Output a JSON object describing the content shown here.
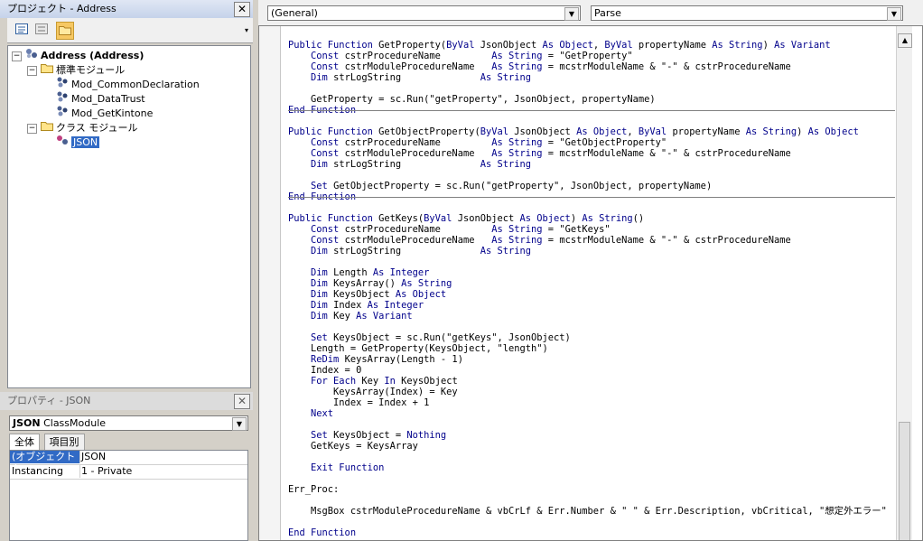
{
  "project": {
    "title": "プロジェクト - Address",
    "close": "✕",
    "tree": [
      {
        "label": "Address (Address)",
        "level": 0,
        "expander": "−",
        "icon": "vba-project-icon",
        "bold": true,
        "selected": false
      },
      {
        "label": "標準モジュール",
        "level": 1,
        "expander": "−",
        "icon": "folder-icon",
        "bold": false,
        "selected": false
      },
      {
        "label": "Mod_CommonDeclaration",
        "level": 2,
        "expander": "",
        "icon": "module-icon",
        "bold": false,
        "selected": false
      },
      {
        "label": "Mod_DataTrust",
        "level": 2,
        "expander": "",
        "icon": "module-icon",
        "bold": false,
        "selected": false
      },
      {
        "label": "Mod_GetKintone",
        "level": 2,
        "expander": "",
        "icon": "module-icon",
        "bold": false,
        "selected": false
      },
      {
        "label": "クラス モジュール",
        "level": 1,
        "expander": "−",
        "icon": "folder-icon",
        "bold": false,
        "selected": false
      },
      {
        "label": "JSON",
        "level": 2,
        "expander": "",
        "icon": "class-module-icon",
        "bold": false,
        "selected": true
      }
    ]
  },
  "properties": {
    "title": "プロパティ - JSON",
    "close": "✕",
    "object_name": "JSON",
    "object_type": "ClassModule",
    "tabs": [
      "全体",
      "項目別"
    ],
    "rows": [
      {
        "name": "(オブジェクト名)",
        "value": "JSON",
        "selected": true
      },
      {
        "name": "Instancing",
        "value": "1 - Private",
        "selected": false
      }
    ]
  },
  "code": {
    "object_combo": "(General)",
    "procedure_combo": "Parse",
    "lines": [
      [
        [
          "kw",
          "Public Function "
        ],
        [
          "",
          "GetProperty("
        ],
        [
          "kw",
          "ByVal "
        ],
        [
          "",
          "JsonObject "
        ],
        [
          "kw",
          "As Object"
        ],
        [
          "",
          ", "
        ],
        [
          "kw",
          "ByVal "
        ],
        [
          "",
          "propertyName "
        ],
        [
          "kw",
          "As String"
        ],
        [
          "",
          ") "
        ],
        [
          "kw",
          "As Variant"
        ]
      ],
      [
        [
          "",
          "    "
        ],
        [
          "kw",
          "Const "
        ],
        [
          "",
          "cstrProcedureName         "
        ],
        [
          "kw",
          "As String"
        ],
        [
          "",
          " = \"GetProperty\""
        ]
      ],
      [
        [
          "",
          "    "
        ],
        [
          "kw",
          "Const "
        ],
        [
          "",
          "cstrModuleProcedureName   "
        ],
        [
          "kw",
          "As String"
        ],
        [
          "",
          " = mcstrModuleName & \"-\" & cstrProcedureName"
        ]
      ],
      [
        [
          "",
          "    "
        ],
        [
          "kw",
          "Dim "
        ],
        [
          "",
          "strLogString              "
        ],
        [
          "kw",
          "As String"
        ]
      ],
      [
        [
          "",
          ""
        ]
      ],
      [
        [
          "",
          "    GetProperty = sc.Run(\"getProperty\", JsonObject, propertyName)"
        ]
      ],
      [
        [
          "kw",
          "End Function"
        ]
      ],
      [
        [
          "",
          ""
        ]
      ],
      [
        [
          "kw",
          "Public Function "
        ],
        [
          "",
          "GetObjectProperty("
        ],
        [
          "kw",
          "ByVal "
        ],
        [
          "",
          "JsonObject "
        ],
        [
          "kw",
          "As Object"
        ],
        [
          "",
          ", "
        ],
        [
          "kw",
          "ByVal "
        ],
        [
          "",
          "propertyName "
        ],
        [
          "kw",
          "As String"
        ],
        [
          "",
          ") "
        ],
        [
          "kw",
          "As Object"
        ]
      ],
      [
        [
          "",
          "    "
        ],
        [
          "kw",
          "Const "
        ],
        [
          "",
          "cstrProcedureName         "
        ],
        [
          "kw",
          "As String"
        ],
        [
          "",
          " = \"GetObjectProperty\""
        ]
      ],
      [
        [
          "",
          "    "
        ],
        [
          "kw",
          "Const "
        ],
        [
          "",
          "cstrModuleProcedureName   "
        ],
        [
          "kw",
          "As String"
        ],
        [
          "",
          " = mcstrModuleName & \"-\" & cstrProcedureName"
        ]
      ],
      [
        [
          "",
          "    "
        ],
        [
          "kw",
          "Dim "
        ],
        [
          "",
          "strLogString              "
        ],
        [
          "kw",
          "As String"
        ]
      ],
      [
        [
          "",
          ""
        ]
      ],
      [
        [
          "",
          "    "
        ],
        [
          "kw",
          "Set "
        ],
        [
          "",
          "GetObjectProperty = sc.Run(\"getProperty\", JsonObject, propertyName)"
        ]
      ],
      [
        [
          "kw",
          "End Function"
        ]
      ],
      [
        [
          "",
          ""
        ]
      ],
      [
        [
          "kw",
          "Public Function "
        ],
        [
          "",
          "GetKeys("
        ],
        [
          "kw",
          "ByVal "
        ],
        [
          "",
          "JsonObject "
        ],
        [
          "kw",
          "As Object"
        ],
        [
          "",
          ") "
        ],
        [
          "kw",
          "As String"
        ],
        [
          "",
          "()"
        ]
      ],
      [
        [
          "",
          "    "
        ],
        [
          "kw",
          "Const "
        ],
        [
          "",
          "cstrProcedureName         "
        ],
        [
          "kw",
          "As String"
        ],
        [
          "",
          " = \"GetKeys\""
        ]
      ],
      [
        [
          "",
          "    "
        ],
        [
          "kw",
          "Const "
        ],
        [
          "",
          "cstrModuleProcedureName   "
        ],
        [
          "kw",
          "As String"
        ],
        [
          "",
          " = mcstrModuleName & \"-\" & cstrProcedureName"
        ]
      ],
      [
        [
          "",
          "    "
        ],
        [
          "kw",
          "Dim "
        ],
        [
          "",
          "strLogString              "
        ],
        [
          "kw",
          "As String"
        ]
      ],
      [
        [
          "",
          ""
        ]
      ],
      [
        [
          "",
          "    "
        ],
        [
          "kw",
          "Dim "
        ],
        [
          "",
          "Length "
        ],
        [
          "kw",
          "As Integer"
        ]
      ],
      [
        [
          "",
          "    "
        ],
        [
          "kw",
          "Dim "
        ],
        [
          "",
          "KeysArray() "
        ],
        [
          "kw",
          "As String"
        ]
      ],
      [
        [
          "",
          "    "
        ],
        [
          "kw",
          "Dim "
        ],
        [
          "",
          "KeysObject "
        ],
        [
          "kw",
          "As Object"
        ]
      ],
      [
        [
          "",
          "    "
        ],
        [
          "kw",
          "Dim "
        ],
        [
          "",
          "Index "
        ],
        [
          "kw",
          "As Integer"
        ]
      ],
      [
        [
          "",
          "    "
        ],
        [
          "kw",
          "Dim "
        ],
        [
          "",
          "Key "
        ],
        [
          "kw",
          "As Variant"
        ]
      ],
      [
        [
          "",
          ""
        ]
      ],
      [
        [
          "",
          "    "
        ],
        [
          "kw",
          "Set "
        ],
        [
          "",
          "KeysObject = sc.Run(\"getKeys\", JsonObject)"
        ]
      ],
      [
        [
          "",
          "    Length = GetProperty(KeysObject, \"length\")"
        ]
      ],
      [
        [
          "",
          "    "
        ],
        [
          "kw",
          "ReDim "
        ],
        [
          "",
          "KeysArray(Length - 1)"
        ]
      ],
      [
        [
          "",
          "    Index = 0"
        ]
      ],
      [
        [
          "",
          "    "
        ],
        [
          "kw",
          "For Each "
        ],
        [
          "",
          "Key "
        ],
        [
          "kw",
          "In "
        ],
        [
          "",
          "KeysObject"
        ]
      ],
      [
        [
          "",
          "        KeysArray(Index) = Key"
        ]
      ],
      [
        [
          "",
          "        Index = Index + 1"
        ]
      ],
      [
        [
          "",
          "    "
        ],
        [
          "kw",
          "Next"
        ]
      ],
      [
        [
          "",
          ""
        ]
      ],
      [
        [
          "",
          "    "
        ],
        [
          "kw",
          "Set "
        ],
        [
          "",
          "KeysObject = "
        ],
        [
          "kw",
          "Nothing"
        ]
      ],
      [
        [
          "",
          "    GetKeys = KeysArray"
        ]
      ],
      [
        [
          "",
          ""
        ]
      ],
      [
        [
          "",
          "    "
        ],
        [
          "kw",
          "Exit Function"
        ]
      ],
      [
        [
          "",
          ""
        ]
      ],
      [
        [
          "",
          "Err_Proc:"
        ]
      ],
      [
        [
          "",
          ""
        ]
      ],
      [
        [
          "",
          "    MsgBox cstrModuleProcedureName & vbCrLf & Err.Number & \" \" & Err.Description, vbCritical, \"想定外エラー\""
        ]
      ],
      [
        [
          "",
          ""
        ]
      ],
      [
        [
          "kw",
          "End Function"
        ]
      ]
    ],
    "separators_after": [
      7,
      15
    ]
  }
}
